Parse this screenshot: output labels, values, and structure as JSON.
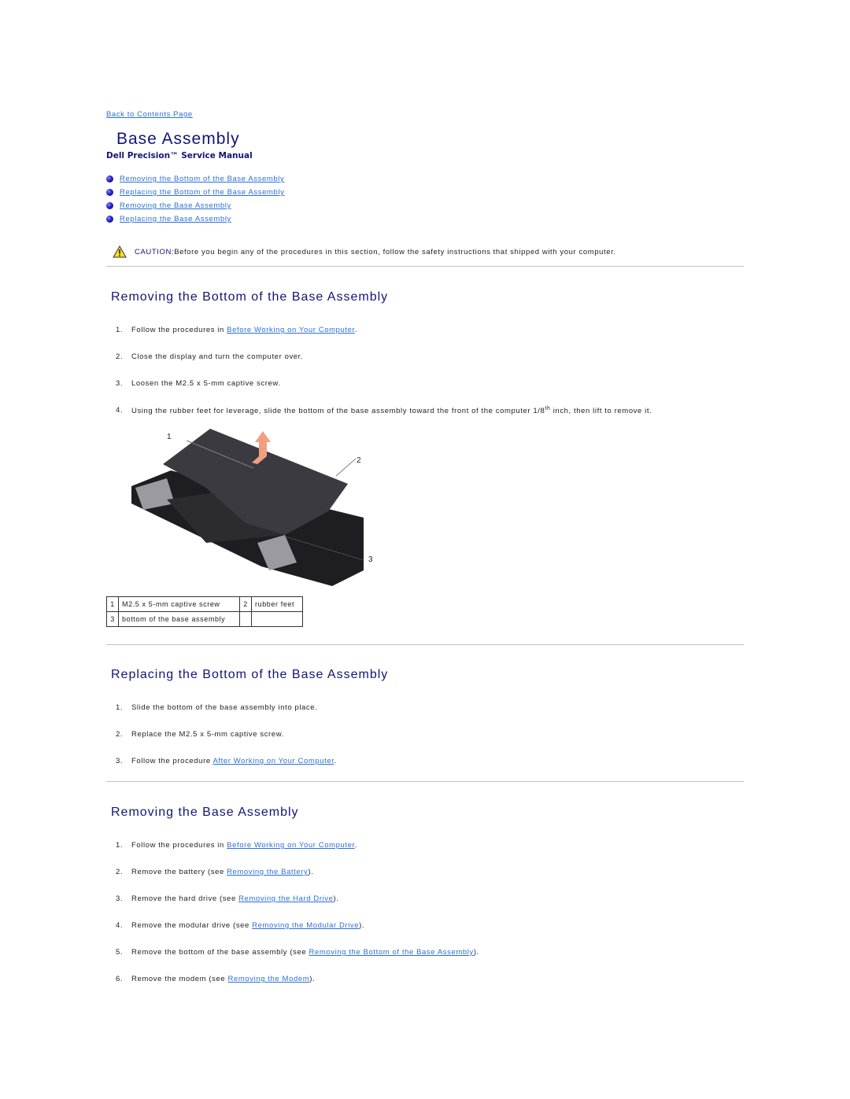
{
  "nav": {
    "back_link": "Back to Contents Page"
  },
  "header": {
    "title": "Base Assembly",
    "subtitle": "Dell Precision™ Service Manual"
  },
  "toc": [
    {
      "label": "Removing the Bottom of the Base Assembly",
      "icon": "blue-bullet-icon"
    },
    {
      "label": "Replacing the Bottom of the Base Assembly",
      "icon": "blue-bullet-icon"
    },
    {
      "label": "Removing the Base Assembly",
      "icon": "blue-bullet-icon"
    },
    {
      "label": "Replacing the Base Assembly",
      "icon": "blue-bullet-icon"
    }
  ],
  "caution": {
    "icon": "warning-triangle-icon",
    "label": "CAUTION:",
    "text": " Before you begin any of the procedures in this section, follow the safety instructions that shipped with your computer."
  },
  "sections": [
    {
      "heading": "Removing the Bottom of the Base Assembly",
      "steps": [
        {
          "num": "1.",
          "before": "Follow the procedures in ",
          "link": "Before Working on Your Computer",
          "after": "."
        },
        {
          "num": "2.",
          "before": "Close the display and turn the computer over.",
          "link": "",
          "after": ""
        },
        {
          "num": "3.",
          "before": "Loosen the M2.5 x 5-mm captive screw.",
          "link": "",
          "after": ""
        },
        {
          "num": "4.",
          "before": "Using the rubber feet for leverage, slide the bottom of the base assembly toward the front of the computer 1/8",
          "sup": "th",
          "link": "",
          "after": " inch, then lift to remove it."
        }
      ],
      "figure": {
        "callouts": [
          "1",
          "2",
          "3"
        ],
        "colors": {
          "panel": "#3a3a40",
          "chassis": "#1e1e22",
          "arrow": "#f0a080",
          "cover": "#9a9aa0"
        }
      },
      "legend": [
        [
          {
            "n": "1",
            "text": "M2.5 x 5-mm captive screw"
          },
          {
            "n": "2",
            "text": "rubber feet"
          }
        ],
        [
          {
            "n": "3",
            "text": "bottom of the base assembly"
          },
          {
            "n": "",
            "text": ""
          }
        ]
      ]
    },
    {
      "heading": "Replacing the Bottom of the Base Assembly",
      "steps": [
        {
          "num": "1.",
          "before": "Slide the bottom of the base assembly into place.",
          "link": "",
          "after": ""
        },
        {
          "num": "2.",
          "before": "Replace the M2.5 x 5-mm captive screw.",
          "link": "",
          "after": ""
        },
        {
          "num": "3.",
          "before": "Follow the procedure ",
          "link": "After Working on Your Computer",
          "after": "."
        }
      ]
    },
    {
      "heading": "Removing the Base Assembly",
      "steps": [
        {
          "num": "1.",
          "before": "Follow the procedures in ",
          "link": "Before Working on Your Computer",
          "after": "."
        },
        {
          "num": "2.",
          "before": "Remove the battery (see ",
          "link": "Removing the Battery",
          "after": ")."
        },
        {
          "num": "3.",
          "before": "Remove the hard drive (see ",
          "link": "Removing the Hard Drive",
          "after": ")."
        },
        {
          "num": "4.",
          "before": "Remove the modular drive (see ",
          "link": "Removing the Modular Drive",
          "after": ")."
        },
        {
          "num": "5.",
          "before": "Remove the bottom of the base assembly (see ",
          "link": "Removing the Bottom of the Base Assembly",
          "after": ")."
        },
        {
          "num": "6.",
          "before": "Remove the modem (see ",
          "link": "Removing the Modem",
          "after": ")."
        }
      ]
    }
  ],
  "colors": {
    "link": "#2a6ed9",
    "heading": "#141478",
    "rule": "#c2c2c2"
  }
}
